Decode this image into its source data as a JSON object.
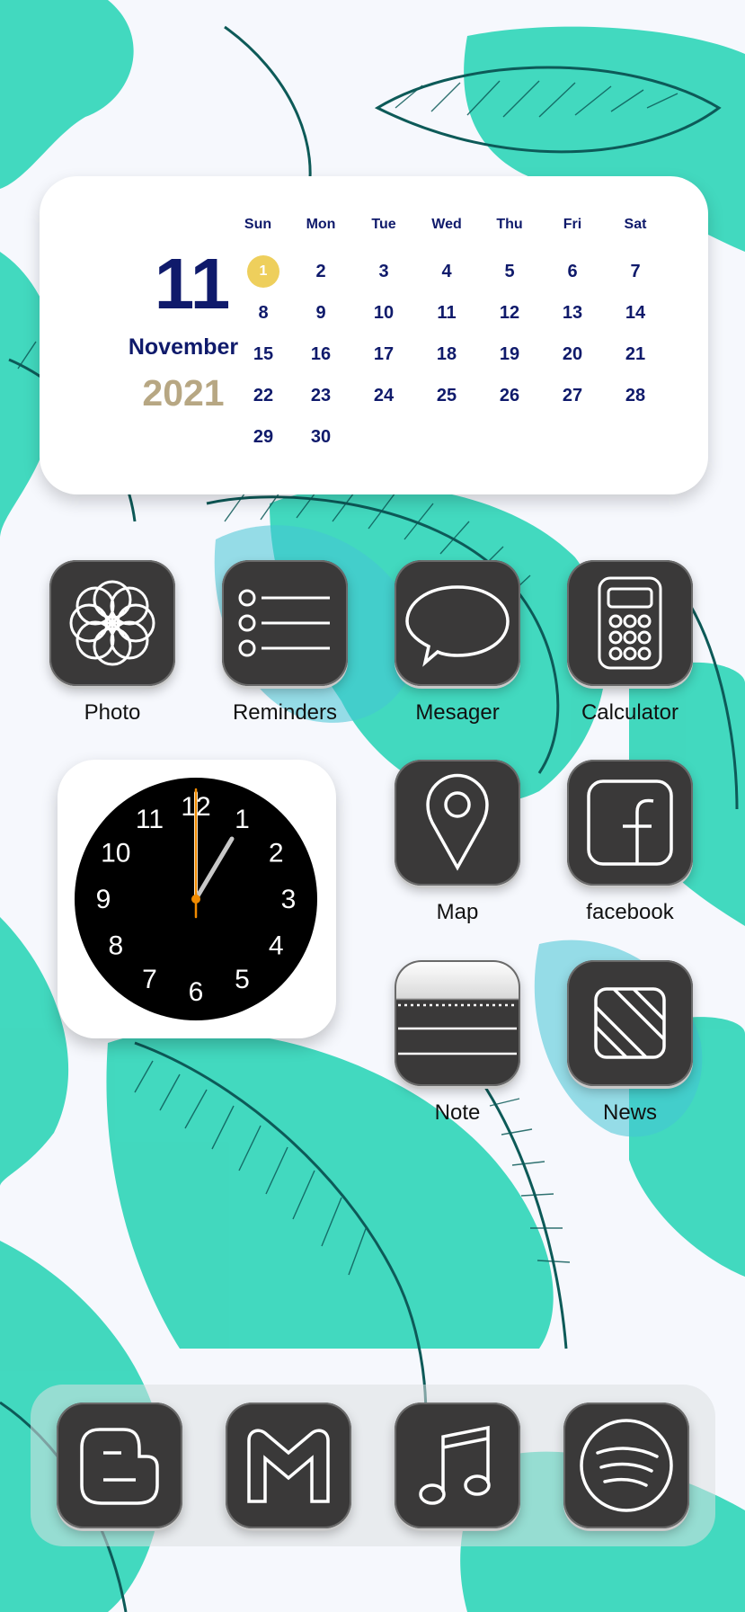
{
  "calendar": {
    "day": "11",
    "month": "November",
    "year": "2021",
    "weekdays": [
      "Sun",
      "Mon",
      "Tue",
      "Wed",
      "Thu",
      "Fri",
      "Sat"
    ],
    "days": [
      "1",
      "2",
      "3",
      "4",
      "5",
      "6",
      "7",
      "8",
      "9",
      "10",
      "11",
      "12",
      "13",
      "14",
      "15",
      "16",
      "17",
      "18",
      "19",
      "20",
      "21",
      "22",
      "23",
      "24",
      "25",
      "26",
      "27",
      "28",
      "29",
      "30"
    ],
    "today": "1",
    "highlight_color": "#eecf5c",
    "text_color": "#0f1a6b",
    "year_color": "#b7a783"
  },
  "clock": {
    "numbers": [
      "12",
      "1",
      "2",
      "3",
      "4",
      "5",
      "6",
      "7",
      "8",
      "9",
      "10",
      "11"
    ],
    "second_hand_color": "#f08a00"
  },
  "apps": {
    "photo": {
      "label": "Photo",
      "icon": "flower-icon"
    },
    "reminders": {
      "label": "Reminders",
      "icon": "list-icon"
    },
    "messenger": {
      "label": "Mesager",
      "icon": "speech-bubble-icon"
    },
    "calculator": {
      "label": "Calculator",
      "icon": "calculator-icon"
    },
    "map": {
      "label": "Map",
      "icon": "map-pin-icon"
    },
    "facebook": {
      "label": "facebook",
      "icon": "facebook-icon"
    },
    "note": {
      "label": "Note",
      "icon": "note-icon"
    },
    "news": {
      "label": "News",
      "icon": "news-icon"
    }
  },
  "dock": [
    {
      "icon": "blogger-icon"
    },
    {
      "icon": "gmail-icon"
    },
    {
      "icon": "music-note-icon"
    },
    {
      "icon": "spotify-icon"
    }
  ],
  "theme": {
    "icon_bg": "#3a3939",
    "leaf_teal": "#2fd5b8",
    "leaf_outline": "#0d5a58"
  }
}
